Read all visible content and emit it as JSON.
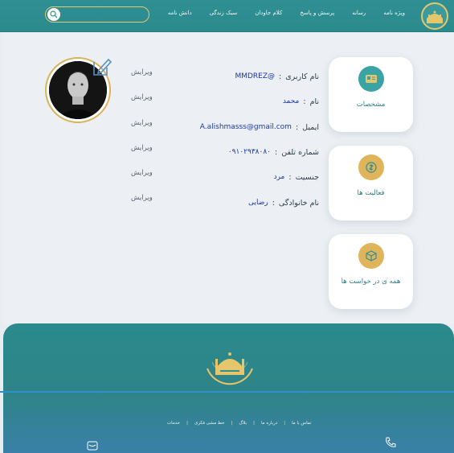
{
  "header": {
    "nav": [
      "دانش نامه",
      "سبک زندگی",
      "کلام جاودان",
      "پرسش و پاسخ",
      "رسانه",
      "ویژه نامه"
    ],
    "search": {
      "placeholder": "",
      "value": ""
    }
  },
  "sidebar": {
    "cards": [
      {
        "label": "مشخصات",
        "icon": "id-card-icon",
        "color": "#3aa3a6"
      },
      {
        "label": "فعالیت ها",
        "icon": "activity-icon",
        "color": "#dfb45a"
      },
      {
        "label": "همه ی در خواست ها",
        "icon": "box-icon",
        "color": "#dfb45a"
      }
    ]
  },
  "profile": {
    "fields": [
      {
        "label": "نام کاربری",
        "value": "@MMDREZ"
      },
      {
        "label": "نام",
        "value": "محمد"
      },
      {
        "label": "ایمیل",
        "value": "A.alishmasss@gmail.com"
      },
      {
        "label": "شماره تلفن",
        "value": "۰۹۱۰۲۹۳۸۰۸۰"
      },
      {
        "label": "جنسیت",
        "value": "مرد"
      },
      {
        "label": "نام خانوادگی",
        "value": "رضایی"
      }
    ],
    "edit_label": "ویرایش"
  },
  "footer": {
    "links": [
      "خدمات",
      "خط مشی فکری",
      "بلاگ",
      "درباره ما",
      "تماس با ما"
    ]
  },
  "colors": {
    "primary": "#2f8f93",
    "accent": "#dfb45a",
    "link": "#1c3aa0"
  }
}
